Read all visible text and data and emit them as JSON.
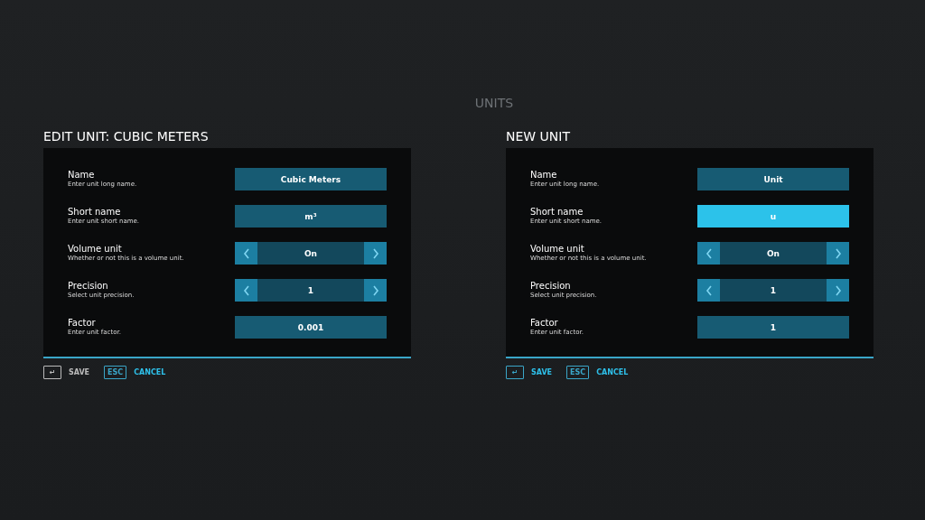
{
  "background": {
    "title": "UNITS"
  },
  "dialogs": [
    {
      "title": "EDIT UNIT: CUBIC METERS",
      "fields": [
        {
          "kind": "text",
          "label": "Name",
          "description": "Enter unit long name.",
          "value": "Cubic Meters",
          "selected": false
        },
        {
          "kind": "text",
          "label": "Short name",
          "description": "Enter unit short name.",
          "value": "m³",
          "selected": false
        },
        {
          "kind": "stepper",
          "label": "Volume unit",
          "description": "Whether or not this is a volume unit.",
          "value": "On",
          "selected": false
        },
        {
          "kind": "stepper",
          "label": "Precision",
          "description": "Select unit precision.",
          "value": "1",
          "selected": false
        },
        {
          "kind": "text",
          "label": "Factor",
          "description": "Enter unit factor.",
          "value": "0.001",
          "selected": false
        }
      ],
      "save": {
        "key": "↵",
        "label": "SAVE",
        "disabled": true
      },
      "cancel": {
        "key": "ESC",
        "label": "CANCEL",
        "disabled": false
      }
    },
    {
      "title": "NEW UNIT",
      "fields": [
        {
          "kind": "text",
          "label": "Name",
          "description": "Enter unit long name.",
          "value": "Unit",
          "selected": false
        },
        {
          "kind": "text",
          "label": "Short name",
          "description": "Enter unit short name.",
          "value": "u",
          "selected": true
        },
        {
          "kind": "stepper",
          "label": "Volume unit",
          "description": "Whether or not this is a volume unit.",
          "value": "On",
          "selected": false
        },
        {
          "kind": "stepper",
          "label": "Precision",
          "description": "Select unit precision.",
          "value": "1",
          "selected": false
        },
        {
          "kind": "text",
          "label": "Factor",
          "description": "Enter unit factor.",
          "value": "1",
          "selected": false
        }
      ],
      "save": {
        "key": "↵",
        "label": "SAVE",
        "disabled": false
      },
      "cancel": {
        "key": "ESC",
        "label": "CANCEL",
        "disabled": false
      }
    }
  ]
}
